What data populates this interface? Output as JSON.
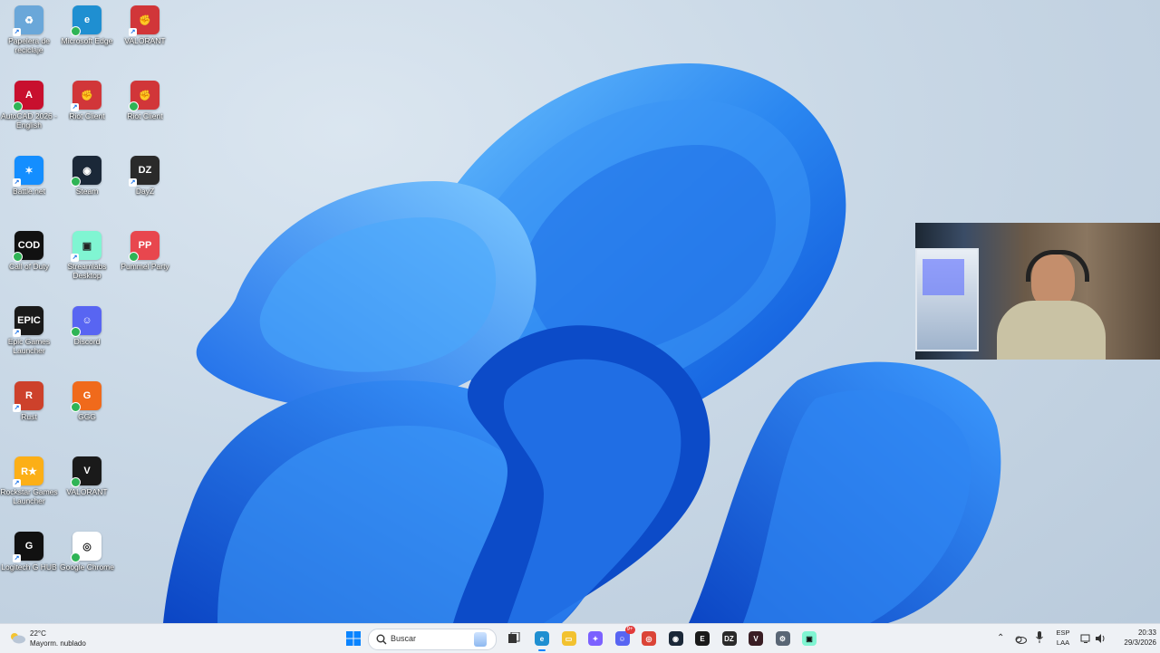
{
  "desktop": {
    "icons": [
      {
        "label": "Papelera de reciclaje",
        "icon": "recycle-bin-icon",
        "color": "#6aa7d9"
      },
      {
        "label": "Microsoft Edge",
        "icon": "edge-icon",
        "color": "#1f8fd1"
      },
      {
        "label": "VALORANT",
        "icon": "riot-icon",
        "color": "#d13639"
      },
      {
        "label": "AutoCAD 2026 - English",
        "icon": "autocad-icon",
        "color": "#c8102e"
      },
      {
        "label": "Riot Client",
        "icon": "riot-icon",
        "color": "#d13639"
      },
      {
        "label": "Riot Client",
        "icon": "riot-icon",
        "color": "#d13639"
      },
      {
        "label": "Battle.net",
        "icon": "battlenet-icon",
        "color": "#148eff"
      },
      {
        "label": "Steam",
        "icon": "steam-icon",
        "color": "#1b2838"
      },
      {
        "label": "DayZ",
        "icon": "dayz-icon",
        "color": "#2a2a2a"
      },
      {
        "label": "Call of Duty",
        "icon": "callofduty-icon",
        "color": "#111111"
      },
      {
        "label": "Streamlabs Desktop",
        "icon": "streamlabs-icon",
        "color": "#80f5d2"
      },
      {
        "label": "Pummel Party",
        "icon": "pummelparty-icon",
        "color": "#e8474e"
      },
      {
        "label": "Epic Games Launcher",
        "icon": "epic-games-icon",
        "color": "#1a1a1a"
      },
      {
        "label": "Discord",
        "icon": "discord-icon",
        "color": "#5865f2"
      },
      {
        "label": "Rust",
        "icon": "rust-icon",
        "color": "#cd412b"
      },
      {
        "label": "GGG",
        "icon": "ggg-icon",
        "color": "#f06a1b"
      },
      {
        "label": "Rockstar Games Launcher",
        "icon": "rockstar-icon",
        "color": "#fcaf17"
      },
      {
        "label": "VALORANT",
        "icon": "valorant-icon",
        "color": "#1a1a1a"
      },
      {
        "label": "Logitech G HUB",
        "icon": "logitech-icon",
        "color": "#111111"
      },
      {
        "label": "Google Chrome",
        "icon": "chrome-icon",
        "color": "#ffffff"
      }
    ]
  },
  "taskbar": {
    "weather": {
      "temp": "22°C",
      "desc": "Mayorm. nublado"
    },
    "search_placeholder": "Buscar",
    "pinned": [
      "start-icon",
      "edge-icon",
      "file-explorer-icon",
      "copilot-icon",
      "discord-icon",
      "chrome-icon",
      "steam-icon",
      "epic-games-icon",
      "dayz-icon",
      "valorant-icon",
      "settings-icon",
      "streamlabs-icon"
    ],
    "discord_badge": "9+",
    "lang_top": "ESP",
    "lang_bottom": "LAA",
    "time": "20:33",
    "date": "29/3/2026"
  },
  "colors": {
    "bloom_dark": "#0a4fd6",
    "bloom_light": "#57b6ff",
    "taskbar_bg": "#eef1f5"
  }
}
